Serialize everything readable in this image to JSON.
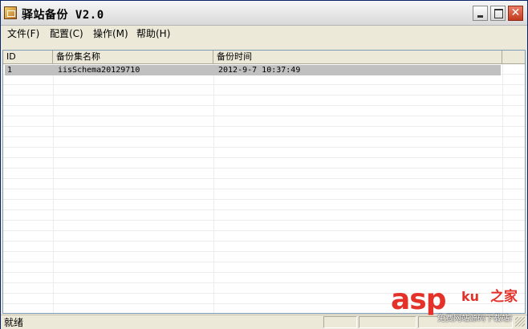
{
  "window": {
    "title": "驿站备份 V2.0"
  },
  "menu": {
    "items": [
      "文件(F)",
      "配置(C)",
      "操作(M)",
      "帮助(H)"
    ]
  },
  "table": {
    "columns": [
      "ID",
      "备份集名称",
      "备份时间"
    ],
    "rows": [
      {
        "id": "1",
        "name": "iisSchema20129710",
        "time": "2012-9-7 10:37:49"
      }
    ]
  },
  "status": {
    "text": "就绪"
  },
  "watermark": {
    "brand": "asp",
    "ku": "ku",
    "jia": "之家",
    "sub": "免费网站源码下载站!"
  },
  "colors": {
    "selected_row": "#c0c0c0",
    "watermark": "#e4322b",
    "close_button": "#c2391e"
  }
}
